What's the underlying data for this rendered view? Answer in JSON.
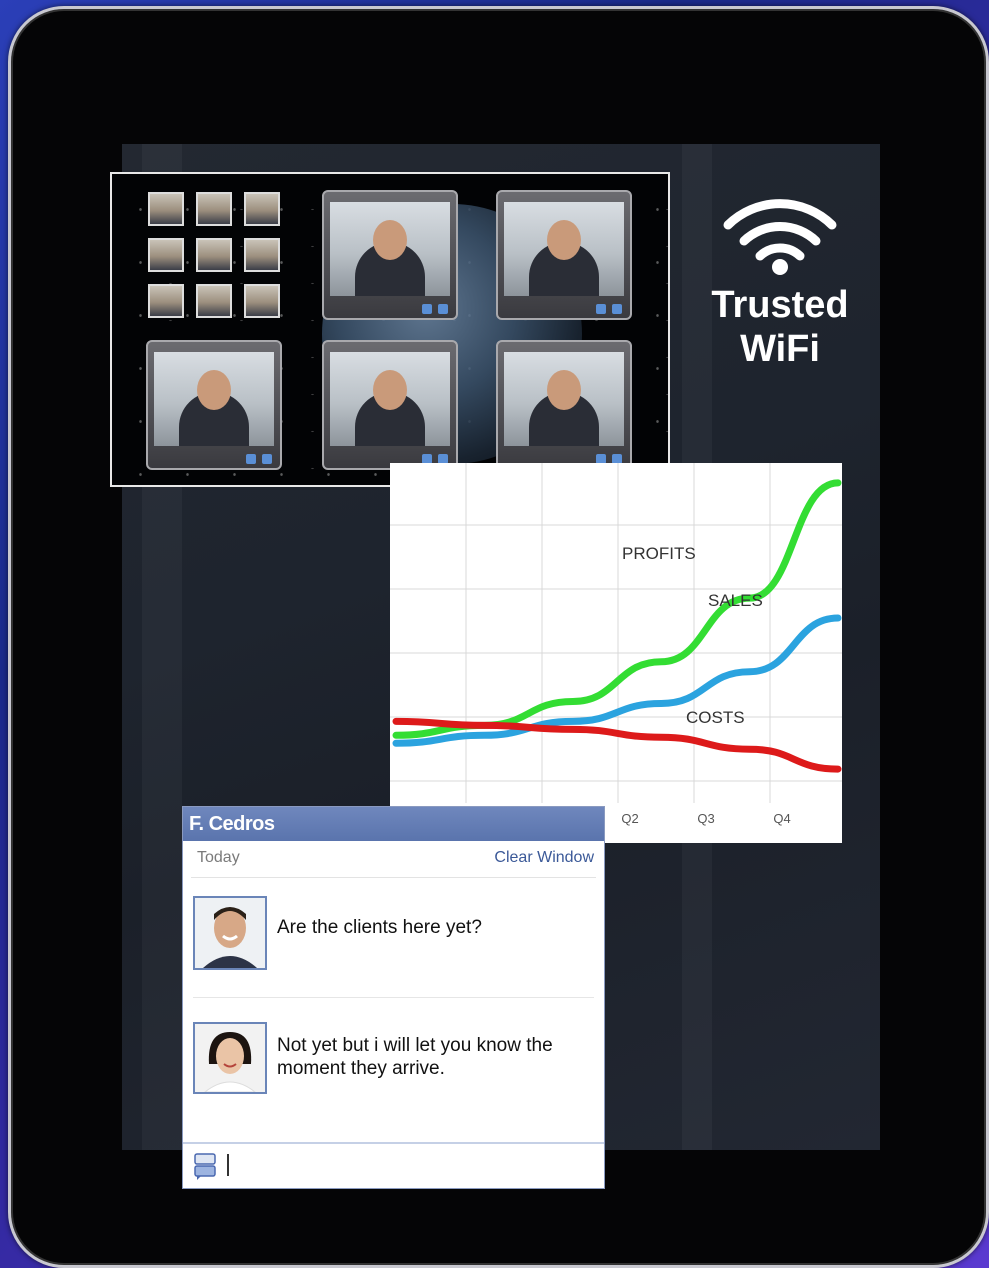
{
  "wifi": {
    "icon": "wifi-icon",
    "label_line1": "Trusted",
    "label_line2": "WiFi"
  },
  "chart_data": {
    "type": "line",
    "categories": [
      "",
      "",
      "",
      "Q2",
      "Q3",
      "Q4"
    ],
    "xlabel": "",
    "ylabel": "",
    "grid": true,
    "series": [
      {
        "name": "PROFITS",
        "color": "#33dd33",
        "values": [
          23,
          28,
          40,
          60,
          92,
          150
        ]
      },
      {
        "name": "SALES",
        "color": "#2ba3df",
        "values": [
          19,
          23,
          30,
          39,
          55,
          82
        ]
      },
      {
        "name": "COSTS",
        "color": "#dd1a1a",
        "values": [
          30,
          28,
          26,
          22,
          16,
          6
        ]
      }
    ],
    "ylim": [
      0,
      160
    ]
  },
  "chat": {
    "contact_name": "F. Cedros",
    "date_label": "Today",
    "clear_label": "Clear Window",
    "messages": [
      {
        "text": "Are the clients here yet?"
      },
      {
        "text": "Not yet but i will let you know the moment they arrive."
      }
    ]
  }
}
